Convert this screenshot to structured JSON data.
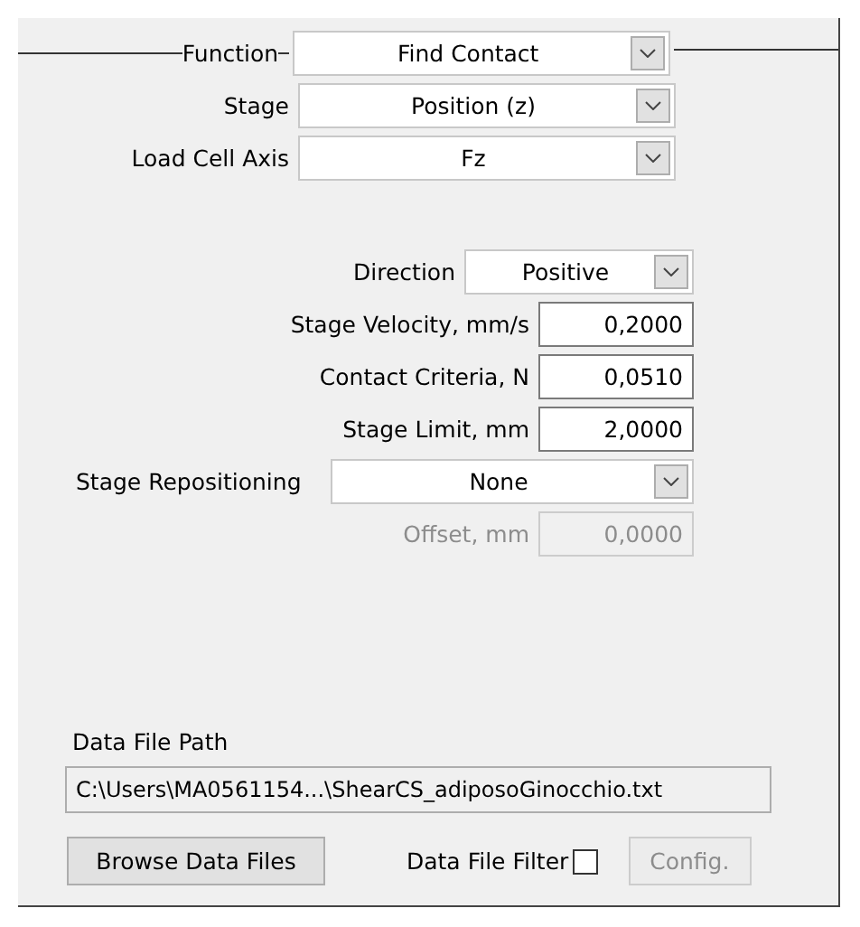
{
  "group": {
    "title": "Function",
    "value": "Find Contact"
  },
  "top_fields": [
    {
      "label": "Stage",
      "value": "Position (z)"
    },
    {
      "label": "Load Cell Axis",
      "value": "Fz"
    }
  ],
  "parameters": [
    {
      "kind": "dropdown",
      "label": "Direction",
      "value": "Positive",
      "disabled": false
    },
    {
      "kind": "number",
      "label": "Stage Velocity, mm/s",
      "value": "0,2000",
      "disabled": false
    },
    {
      "kind": "number",
      "label": "Contact Criteria, N",
      "value": "0,0510",
      "disabled": false
    },
    {
      "kind": "number",
      "label": "Stage Limit, mm",
      "value": "2,0000",
      "disabled": false
    },
    {
      "kind": "wide_dropdown",
      "label": "Stage Repositioning",
      "value": "None",
      "disabled": false
    },
    {
      "kind": "number",
      "label": "Offset, mm",
      "value": "0,0000",
      "disabled": true
    }
  ],
  "data_file": {
    "label": "Data File Path",
    "value": "C:\\Users\\MA0561154...\\ShearCS_adiposoGinocchio.txt"
  },
  "browse_button": "Browse Data Files",
  "filter": {
    "label": "Data File Filter",
    "checked": false
  },
  "config_button": {
    "label": "Config.",
    "disabled": true
  }
}
